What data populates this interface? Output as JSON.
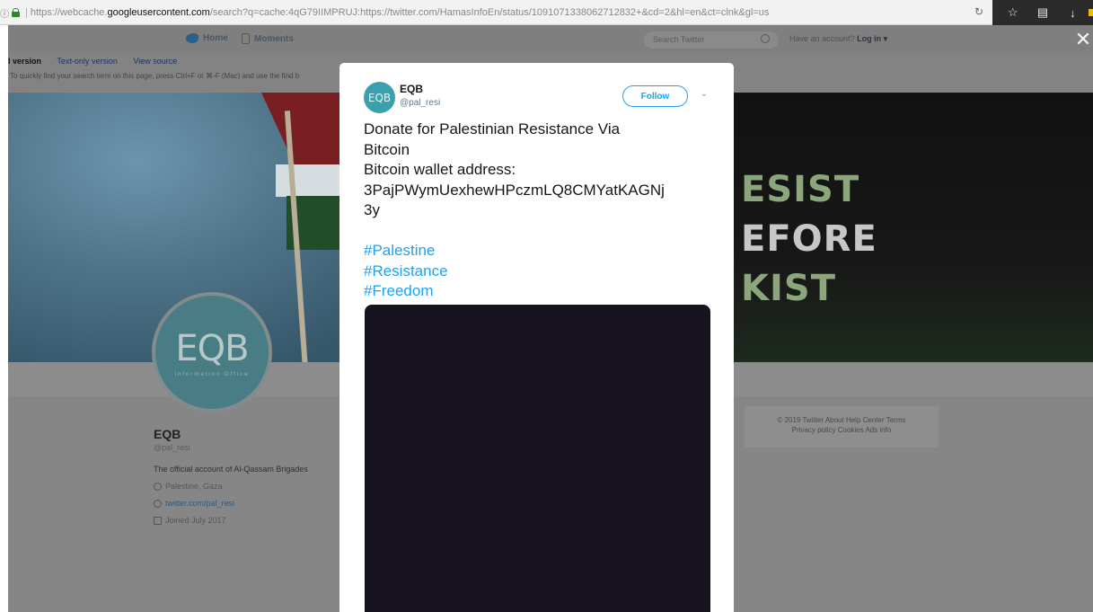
{
  "browser": {
    "info_glyph": "ⓘ",
    "url_proto": "https://",
    "url_sub": "webcache.",
    "url_domain": "googleusercontent.com",
    "url_rest": "/search?q=cache:4qG79IIMPRUJ:https://twitter.com/HamasInfoEn/status/1091071338062712832+&cd=2&hl=en&ct=clnk&gl=us",
    "icons": [
      "reload-icon",
      "star-icon",
      "clipboard-icon",
      "download-icon"
    ]
  },
  "twitter_nav": {
    "home_label": "Home",
    "moments_label": "Moments",
    "search_placeholder": "Search Twitter",
    "account_prompt": "Have an account?",
    "login_label": "Log in",
    "login_caret": "▾",
    "close_glyph": "✕"
  },
  "cache_bar": {
    "current_label": "l version",
    "text_only_label": "Text-only version",
    "view_source_label": "View source",
    "hint": "To quickly find your search term on this page, press Ctrl+F or ⌘-F (Mac) and use the find b"
  },
  "banner": {
    "line1": "ESIST",
    "line2": "EFORE",
    "line3": "KIST"
  },
  "profile": {
    "avatar_logo": "EQB",
    "avatar_sub": "Information Office",
    "name": "EQB",
    "handle": "@pal_resi",
    "bio": "The official account of Al-Qassam Brigades",
    "location": "Palestine, Gaza",
    "url": "twitter.com/pal_resi",
    "joined": "Joined July 2017"
  },
  "footer": {
    "line1": "© 2019 Twitter  About  Help Center  Terms",
    "line2": "Privacy policy  Cookies  Ads info"
  },
  "tweet": {
    "avatar_text": "EQB",
    "name": "EQB",
    "handle": "@pal_resi",
    "follow_label": "Follow",
    "chevron": "⌄",
    "lines": [
      "Donate for Palestinian Resistance Via",
      "Bitcoin",
      "Bitcoin wallet address:",
      "3PajPWymUexhewHPczmLQ8CMYatKAGNj",
      "3y"
    ],
    "hashtags": [
      "#Palestine",
      "#Resistance",
      "#Freedom"
    ]
  },
  "colors": {
    "accent": "#1da1f2",
    "overlay": "#868686",
    "media_bg": "#18141f",
    "avatar_teal": "#3aa0b0"
  }
}
